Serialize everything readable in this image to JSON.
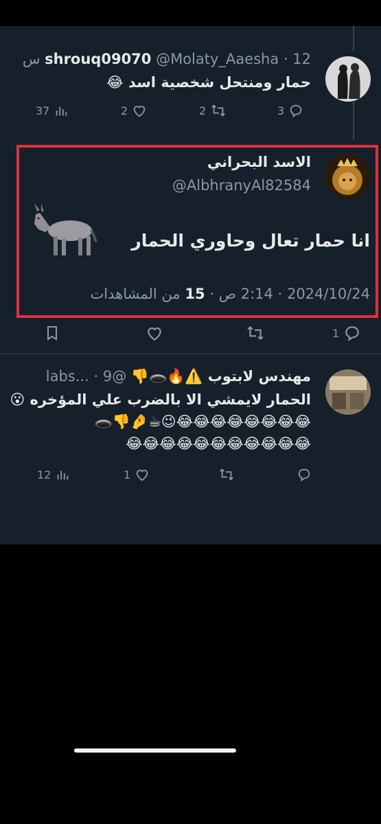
{
  "tweet1": {
    "display_name": "shrouq09070",
    "handle": "@Molaty_Aaesha",
    "separator": "·",
    "time": "12 س",
    "body": "حمار ومنتحل شخصية اسد 😂",
    "replies": "3",
    "retweets": "2",
    "likes": "2",
    "views": "37"
  },
  "tweet2": {
    "display_name": "الاسد البحراني",
    "handle": "@AlbhranyAl82584",
    "body": "انا حمار تعال وحاوري الحمار",
    "media_emoji": "🫏",
    "date": "2024/10/24",
    "time": "2:14 ص",
    "views_count": "15",
    "views_label": "من المشاهدات",
    "sep": "·",
    "replies": "1"
  },
  "tweet3": {
    "display_name": "مهندس لابتوب ⚠️🔥🕳️👎",
    "handle": "@labs...",
    "time_partial": "9",
    "separator": "·",
    "line1": "الحمار لايمشي الا بالضرب علي المؤخره 😮",
    "line2": "😂😂😂😂😂😂😂😂😉☕🤌👎🕳️",
    "line3": "😂😂😂😂😂😂😂😂😂😂😂",
    "replies": "",
    "retweets": "",
    "likes": "1",
    "views": "12"
  },
  "colors": {
    "background": "#15202b",
    "highlight_border": "#e0303d",
    "muted": "#8b98a5"
  }
}
